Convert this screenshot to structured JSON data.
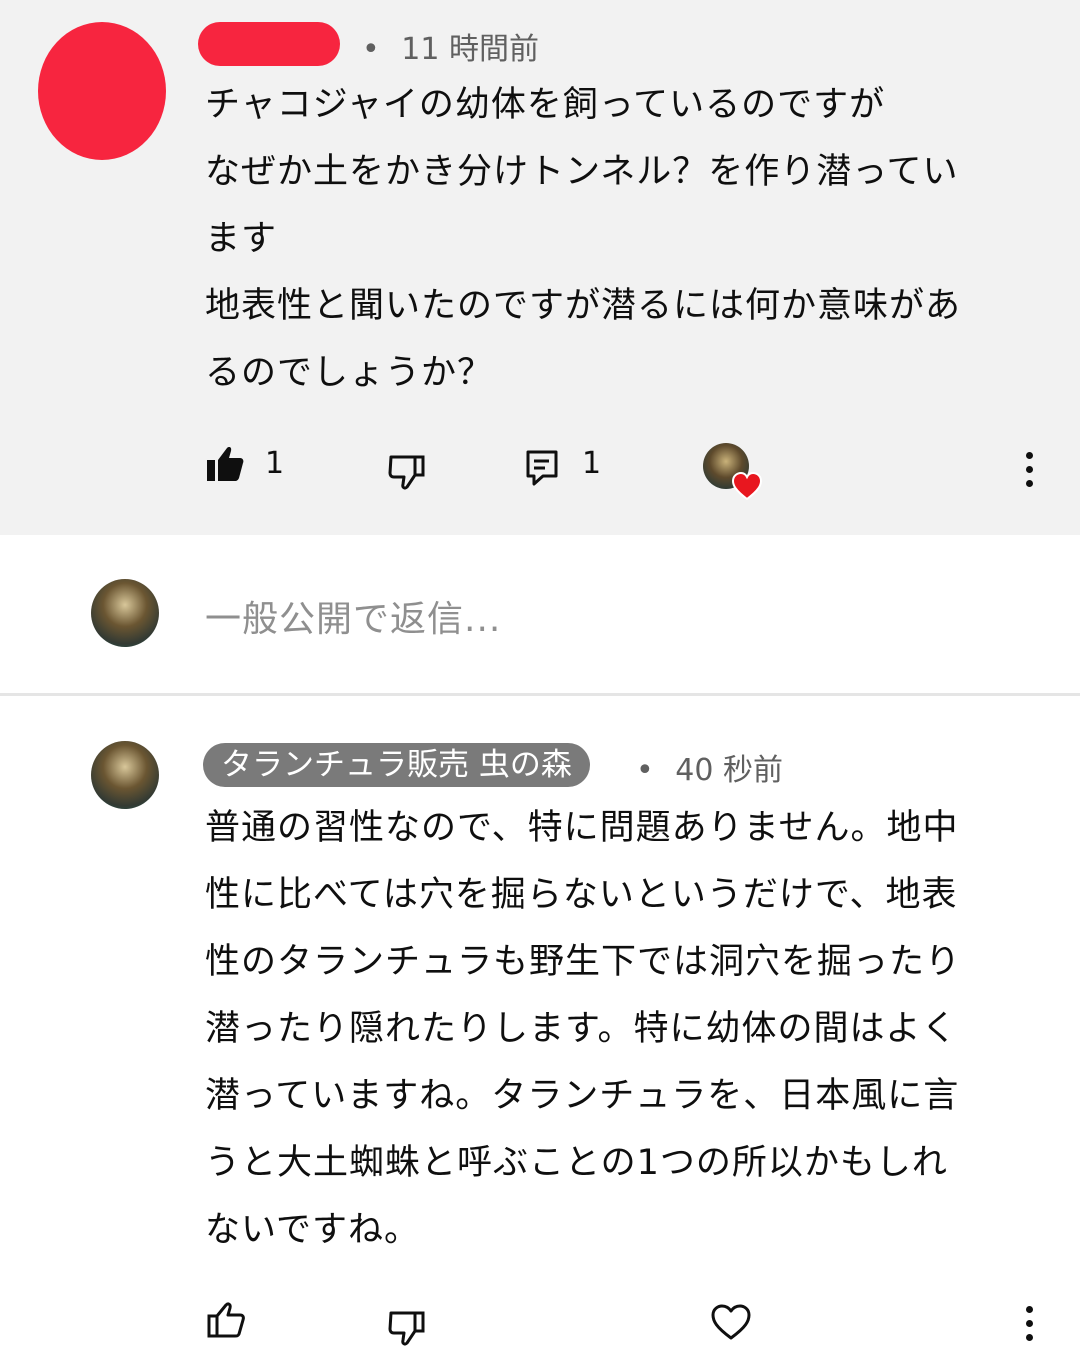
{
  "parent_comment": {
    "dot": "•",
    "time": "11 時間前",
    "text": "チャコジャイの幼体を飼っているのですが\nなぜか土をかき分けトンネル？を作り潜ってい\nます\n地表性と聞いたのですが潜るには何か意味があ\nるのでしょうか？",
    "like_count": "1",
    "reply_count": "1",
    "icons": {
      "like": "thumbs-up-filled-icon",
      "dislike": "thumbs-down-icon",
      "replies": "comment-icon",
      "heart_badge": "creator-heart-icon",
      "menu": "more-vertical-icon"
    }
  },
  "reply_box": {
    "placeholder": "一般公開で返信..."
  },
  "reply_comment": {
    "author": "タランチュラ販売 虫の森",
    "dot": "•",
    "time": "40 秒前",
    "text": "普通の習性なので、特に問題ありません。地中\n性に比べては穴を掘らないというだけで、地表\n性のタランチュラも野生下では洞穴を掘ったり\n潜ったり隠れたりします。特に幼体の間はよく\n潜っていますね。タランチュラを、日本風に言\nうと大土蜘蛛と呼ぶことの1つの所以かもしれ\nないですね。",
    "icons": {
      "like": "thumbs-up-outline-icon",
      "dislike": "thumbs-down-icon",
      "heart": "heart-outline-icon",
      "menu": "more-vertical-icon"
    }
  },
  "colors": {
    "thread_bg": "#f2f2f2",
    "redaction": "#f7253f",
    "heart": "#e8171f",
    "chip_bg": "#7a7a7a",
    "meta_text": "#606060"
  }
}
